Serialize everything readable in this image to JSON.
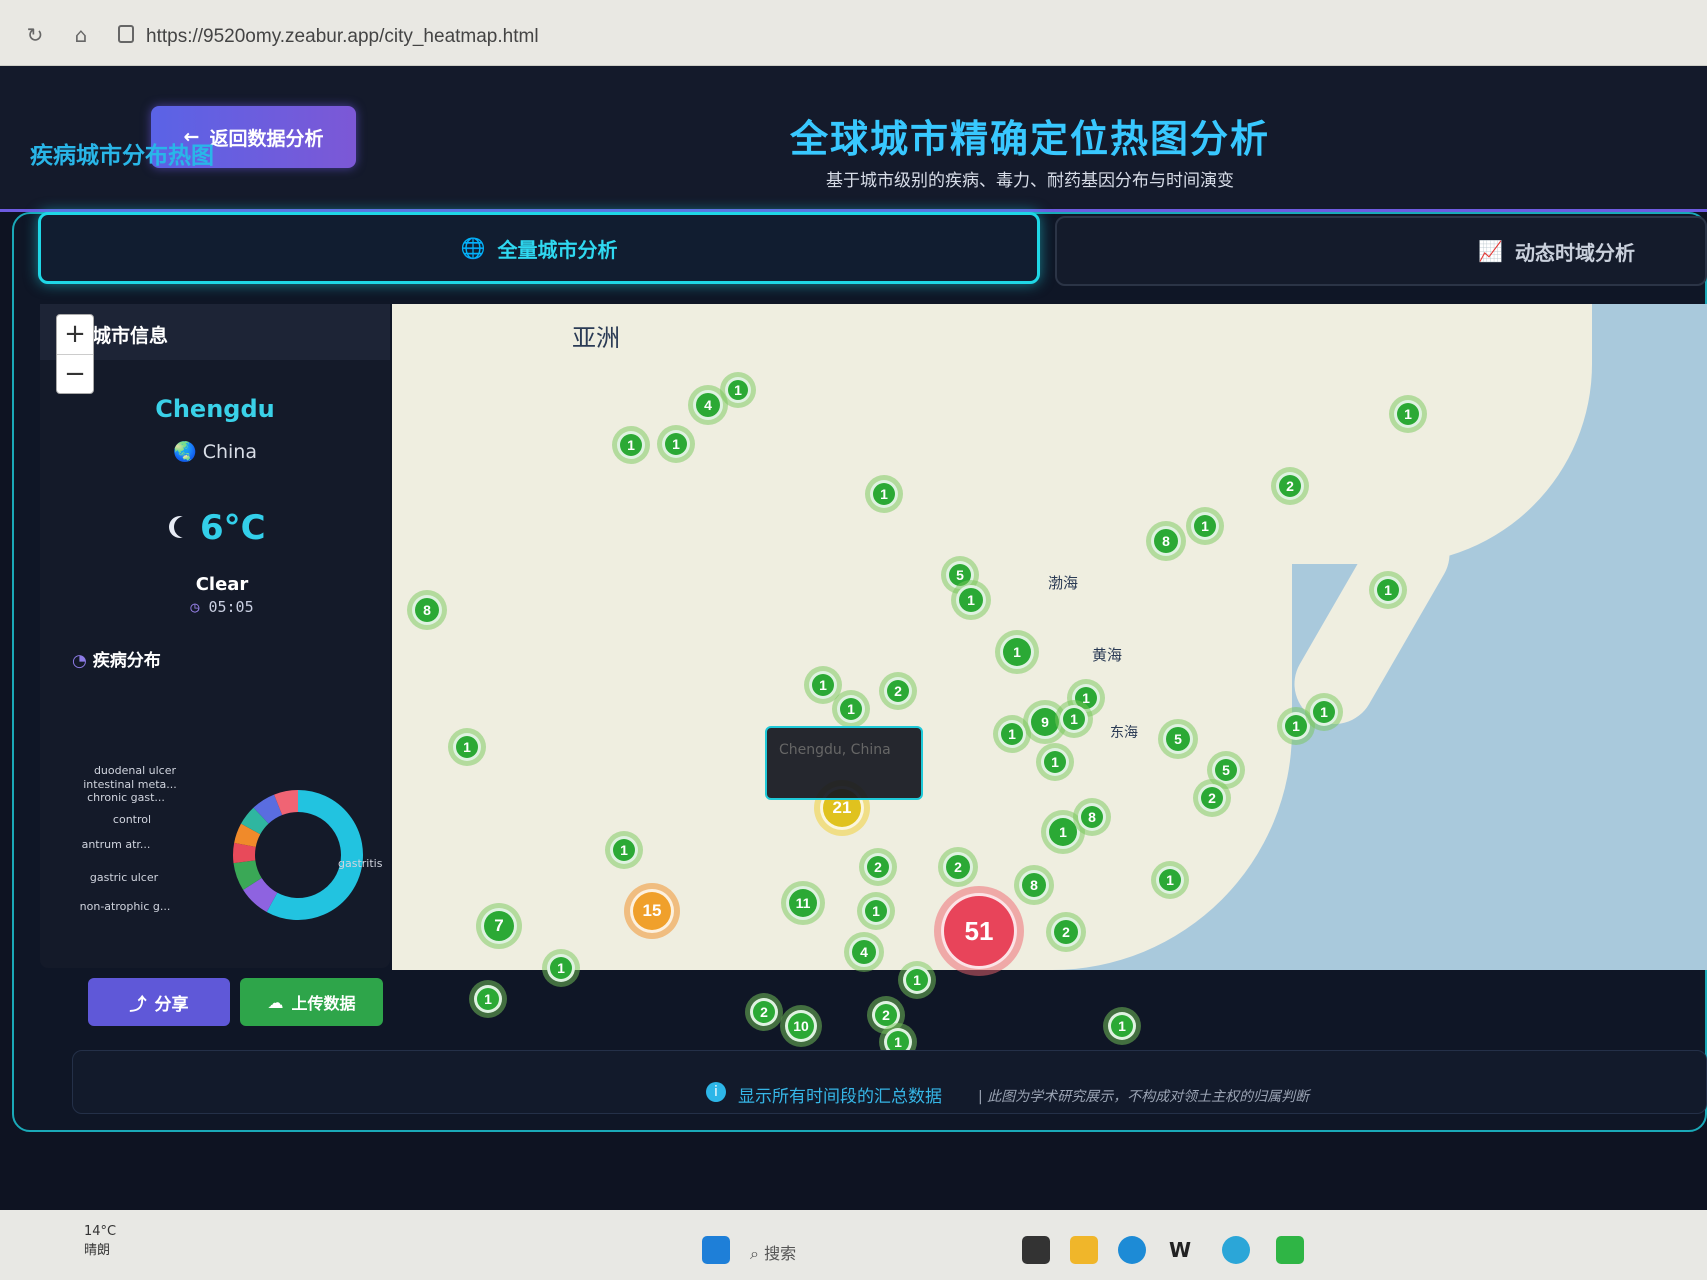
{
  "browser": {
    "url": "https://9520omy.zeabur.app/city_heatmap.html"
  },
  "header": {
    "back_label": "返回数据分析",
    "title": "全球城市精确定位热图分析",
    "subtitle": "基于城市级别的疾病、毒力、耐药基因分布与时间演变"
  },
  "section": {
    "title": "疾病城市分布热图"
  },
  "tabs": {
    "all_cities": "全量城市分析",
    "temporal": "动态时域分析"
  },
  "city_info": {
    "header": "城市信息",
    "city": "Chengdu",
    "country": "China",
    "temperature": "6°C",
    "weather": "Clear",
    "time": "05:05",
    "disease_title": "疾病分布",
    "disease_labels": [
      "duodenal ulcer",
      "intestinal meta...",
      "chronic gast...",
      "control",
      "antrum atr...",
      "gastric ulcer",
      "non-atrophic g...",
      "gastritis"
    ]
  },
  "donut": {
    "slices": [
      {
        "label": "gastritis",
        "value": 58,
        "color": "#22c3e0"
      },
      {
        "label": "non-atrophic g...",
        "value": 8,
        "color": "#8e63e0"
      },
      {
        "label": "gastric ulcer",
        "value": 7,
        "color": "#3aa856"
      },
      {
        "label": "antrum atr...",
        "value": 5,
        "color": "#e84a5a"
      },
      {
        "label": "control",
        "value": 5,
        "color": "#f08a2a"
      },
      {
        "label": "chronic gast...",
        "value": 5,
        "color": "#2fb6a0"
      },
      {
        "label": "intestinal meta...",
        "value": 6,
        "color": "#5a6de0"
      },
      {
        "label": "duodenal ulcer",
        "value": 6,
        "color": "#f06474"
      }
    ]
  },
  "actions": {
    "share": "分享",
    "upload": "上传数据"
  },
  "map": {
    "labels": {
      "asia": "亚洲",
      "bohai": "渤海",
      "yellow_sea": "黄海",
      "east_sea": "东海"
    },
    "tooltip": "Chengdu, China",
    "zoom_in": "+",
    "zoom_out": "−"
  },
  "markers": [
    {
      "count": "4"
    },
    {
      "count": "1"
    },
    {
      "count": "1"
    },
    {
      "count": "1"
    },
    {
      "count": "1"
    },
    {
      "count": "8"
    },
    {
      "count": "1"
    },
    {
      "count": "2"
    },
    {
      "count": "8"
    },
    {
      "count": "1"
    },
    {
      "count": "1"
    },
    {
      "count": "5"
    },
    {
      "count": "1"
    },
    {
      "count": "1"
    },
    {
      "count": "1"
    },
    {
      "count": "2"
    },
    {
      "count": "1"
    },
    {
      "count": "9"
    },
    {
      "count": "1"
    },
    {
      "count": "5"
    },
    {
      "count": "5"
    },
    {
      "count": "2"
    },
    {
      "count": "1"
    },
    {
      "count": "1"
    },
    {
      "count": "1"
    },
    {
      "count": "21"
    },
    {
      "count": "1"
    },
    {
      "count": "8"
    },
    {
      "count": "1"
    },
    {
      "count": "15"
    },
    {
      "count": "7"
    },
    {
      "count": "11"
    },
    {
      "count": "1"
    },
    {
      "count": "4"
    },
    {
      "count": "51"
    },
    {
      "count": "8"
    },
    {
      "count": "2"
    },
    {
      "count": "1"
    },
    {
      "count": "2"
    },
    {
      "count": "10"
    },
    {
      "count": "2"
    },
    {
      "count": "1"
    },
    {
      "count": "1"
    },
    {
      "count": "1"
    },
    {
      "count": "1"
    },
    {
      "count": "1"
    },
    {
      "count": "1"
    },
    {
      "count": "2"
    },
    {
      "count": "2"
    },
    {
      "count": "1"
    },
    {
      "count": "1"
    }
  ],
  "footer": {
    "text": "显示所有时间段的汇总数据",
    "note": "| 此图为学术研究展示，不构成对领土主权的归属判断"
  },
  "taskbar": {
    "temp": "14°C",
    "weather": "晴朗",
    "search": "搜索"
  }
}
